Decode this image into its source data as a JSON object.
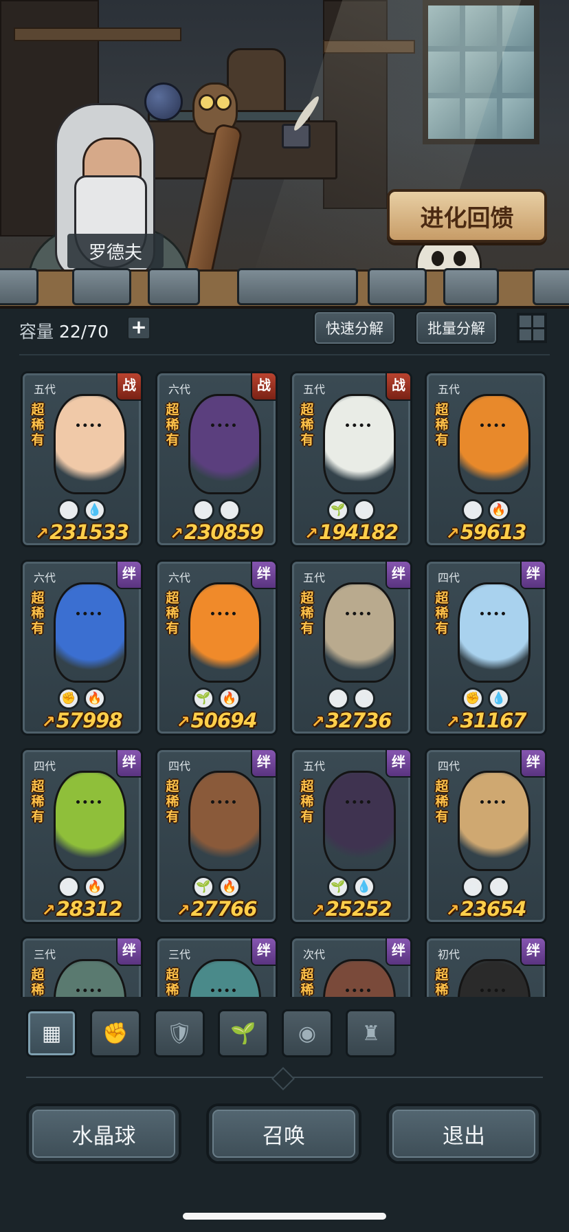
{
  "npc": {
    "name": "罗德夫"
  },
  "evolve_banner": "进化回馈",
  "header": {
    "capacity_label": "容量",
    "capacity_value": "22/70",
    "plus": "+",
    "quick_decompose": "快速分解",
    "batch_decompose": "批量分解"
  },
  "rarity_text": "超稀有",
  "cards": [
    {
      "gen": "五代",
      "tag": "战",
      "power": "231533",
      "icons": [
        "🛡",
        "💧"
      ],
      "color": "#f0c9a8"
    },
    {
      "gen": "六代",
      "tag": "战",
      "power": "230859",
      "icons": [
        "🛡",
        "⛰"
      ],
      "color": "#5b3f7e"
    },
    {
      "gen": "五代",
      "tag": "战",
      "power": "194182",
      "icons": [
        "🌱",
        "⛰"
      ],
      "color": "#e9ece6"
    },
    {
      "gen": "五代",
      "tag": "",
      "power": "59613",
      "icons": [
        "🛡",
        "🔥"
      ],
      "color": "#e8892b"
    },
    {
      "gen": "六代",
      "tag": "绊",
      "power": "57998",
      "icons": [
        "✊",
        "🔥"
      ],
      "color": "#3b6fd1"
    },
    {
      "gen": "六代",
      "tag": "绊",
      "power": "50694",
      "icons": [
        "🌱",
        "🔥"
      ],
      "color": "#f08a2a"
    },
    {
      "gen": "五代",
      "tag": "绊",
      "power": "32736",
      "icons": [
        "◉",
        "⛰"
      ],
      "color": "#b9aa8e"
    },
    {
      "gen": "四代",
      "tag": "绊",
      "power": "31167",
      "icons": [
        "✊",
        "💧"
      ],
      "color": "#a9d2ee"
    },
    {
      "gen": "四代",
      "tag": "绊",
      "power": "28312",
      "icons": [
        "◉",
        "🔥"
      ],
      "color": "#8fbf3a"
    },
    {
      "gen": "四代",
      "tag": "绊",
      "power": "27766",
      "icons": [
        "🌱",
        "🔥"
      ],
      "color": "#8a5a3a"
    },
    {
      "gen": "五代",
      "tag": "绊",
      "power": "25252",
      "icons": [
        "🌱",
        "💧"
      ],
      "color": "#3f3350"
    },
    {
      "gen": "四代",
      "tag": "绊",
      "power": "23654",
      "icons": [
        "◉",
        "⛰"
      ],
      "color": "#cfa871"
    },
    {
      "gen": "三代",
      "tag": "绊",
      "power": "",
      "icons": [],
      "color": "#5a7a70"
    },
    {
      "gen": "三代",
      "tag": "绊",
      "power": "",
      "icons": [],
      "color": "#4a8a8a"
    },
    {
      "gen": "次代",
      "tag": "绊",
      "power": "",
      "icons": [],
      "color": "#7a4a3a"
    },
    {
      "gen": "初代",
      "tag": "绊",
      "power": "",
      "icons": [],
      "color": "#2a2a2a"
    }
  ],
  "filters": [
    {
      "name": "all-filter",
      "glyph": "▦",
      "active": true
    },
    {
      "name": "fist-filter",
      "glyph": "✊",
      "active": false
    },
    {
      "name": "shield-filter",
      "glyph": "🛡",
      "active": false
    },
    {
      "name": "sprout-filter",
      "glyph": "🌱",
      "active": false
    },
    {
      "name": "orb-filter",
      "glyph": "◉",
      "active": false
    },
    {
      "name": "tower-filter",
      "glyph": "♜",
      "active": false
    }
  ],
  "buttons": {
    "crystal_ball": "水晶球",
    "summon": "召唤",
    "exit": "退出"
  },
  "colors": {
    "power_gold": "#ffcf4a",
    "rarity_gold": "#ffc24a",
    "zhan_tag": "#b9432f",
    "ban_tag": "#8656b0"
  }
}
